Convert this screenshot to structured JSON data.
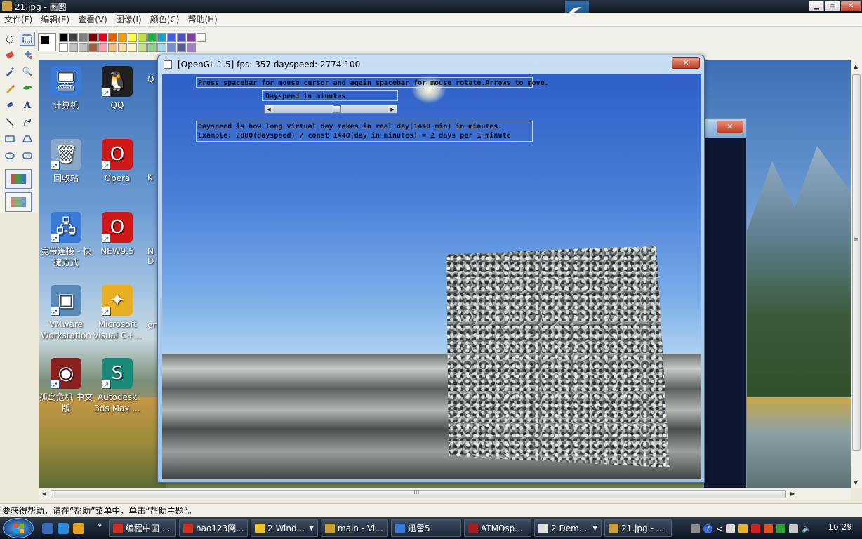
{
  "paint": {
    "title": "21.jpg - 画图",
    "menu": [
      "文件(F)",
      "编辑(E)",
      "查看(V)",
      "图像(I)",
      "颜色(C)",
      "帮助(H)"
    ],
    "status_text": "要获得帮助，请在“帮助”菜单中，单击“帮助主题”。",
    "palette_colors": [
      "#000000",
      "#404040",
      "#808080",
      "#800000",
      "#e00020",
      "#e06000",
      "#f0a000",
      "#ffff40",
      "#c0e040",
      "#20b040",
      "#20a0c0",
      "#4060e0",
      "#5050c0",
      "#8040a0",
      "#fafafa",
      "#ffffff",
      "#c0c0c0",
      "#c0c0c0",
      "#a06040",
      "#f0a0b0",
      "#f0c080",
      "#f8e0a0",
      "#f8f8c0",
      "#c0e090",
      "#90d090",
      "#a0d8e8",
      "#7090d0",
      "#506090",
      "#a080c0"
    ],
    "window_controls": {
      "minimize": "▁",
      "maximize": "▭",
      "close": "✕"
    },
    "tool_glyphs": {
      "text_tool": "A",
      "magnifier": "🔍"
    }
  },
  "desktop": {
    "icons": [
      {
        "label": "计算机",
        "icon": "computer-icon",
        "color": "#3a7ad8"
      },
      {
        "label": "QQ",
        "icon": "qq-icon",
        "color": "#202020"
      },
      {
        "label": "回收站",
        "icon": "recycle-bin-icon",
        "color": "#8aa8c8"
      },
      {
        "label": "Opera",
        "icon": "opera-icon",
        "color": "#d01818"
      },
      {
        "label": "宽带连接 - 快捷方式",
        "icon": "network-icon",
        "color": "#3a7ad8"
      },
      {
        "label": "NEW9.5",
        "icon": "opera-icon",
        "color": "#d01818"
      },
      {
        "label": "VMware Workstation",
        "icon": "vmware-icon",
        "color": "#5a8ab8"
      },
      {
        "label": "Microsoft Visual C+...",
        "icon": "visual-cpp-icon",
        "color": "#e8b020"
      },
      {
        "label": "孤岛危机 中文版",
        "icon": "crysis-icon",
        "color": "#8a2020"
      },
      {
        "label": "Autodesk 3ds Max ...",
        "icon": "3dsmax-icon",
        "color": "#1a8a7a"
      }
    ],
    "partial_labels": [
      "Q",
      "K",
      "N D",
      "en"
    ],
    "icon_glyphs": {
      "shortcut_arrow": "➚",
      "computer": "🖥",
      "qq": "🐧",
      "recycle_bin": "🗑",
      "opera": "O",
      "network": "🖧",
      "vmware": "▣",
      "visual_cpp": "✦",
      "crysis": "◉",
      "3dsmax": "S"
    }
  },
  "gl_window": {
    "title": "[OpenGL 1.5] fps: 357 dayspeed: 2774.100",
    "help_line": "Press spacebar for mouse cursor and again spacebar for mouse rotate.Arrows to move.",
    "slider_label": "Dayspeed in minutes",
    "slider_value_fraction": 0.55,
    "info_line1": "Dayspeed is how long virtual day takes in real day(1440 min) in minutes.",
    "info_line2": "Example: 2880(dayspeed) / const 1440(day in minutes) = 2 days per 1 minute",
    "close_glyph": "✕",
    "slider_arrows": {
      "left": "◀",
      "right": "▶"
    }
  },
  "background_window": {
    "close_glyph": "✕"
  },
  "scrollbars": {
    "up": "▲",
    "down": "▼",
    "left": "◀",
    "right": "▶",
    "grip_h": "⁞⁞⁞",
    "grip_v": "≡"
  },
  "taskbar": {
    "tasks": [
      {
        "label": "编程中国 ...",
        "color": "#d03020",
        "width": 96,
        "group": false
      },
      {
        "label": "hao123网...",
        "color": "#d03020",
        "width": 98,
        "group": false
      },
      {
        "label": "2 Wind...",
        "color": "#e8c030",
        "width": 96,
        "group": true,
        "count": "2"
      },
      {
        "label": "main - Vi...",
        "color": "#c8a030",
        "width": 96,
        "group": false
      },
      {
        "label": "迅雷5",
        "color": "#3a7ad8",
        "width": 100,
        "group": false
      },
      {
        "label": "ATMOsp...",
        "color": "#a02020",
        "width": 96,
        "group": false
      },
      {
        "label": "2 Dem...",
        "color": "#e0e0e0",
        "width": 96,
        "group": true,
        "count": "2"
      },
      {
        "label": "21.jpg - ...",
        "color": "#c8a040",
        "width": 96,
        "group": false
      }
    ],
    "clock": "16:29",
    "dropdown_glyph": "▼",
    "quick_launch_colors": [
      "#3a6ab8",
      "#2a8ad8",
      "#e0a020"
    ],
    "show_more": "»",
    "tray_colors": [
      "#8a8a8a",
      "#3a6ad8",
      "#d8d8d8",
      "#e8b030",
      "#d02020",
      "#e05020",
      "#30a030",
      "#c8c8c8"
    ],
    "tray_glyphs": {
      "help": "?",
      "overflow": "<",
      "volume": "🔈"
    }
  }
}
